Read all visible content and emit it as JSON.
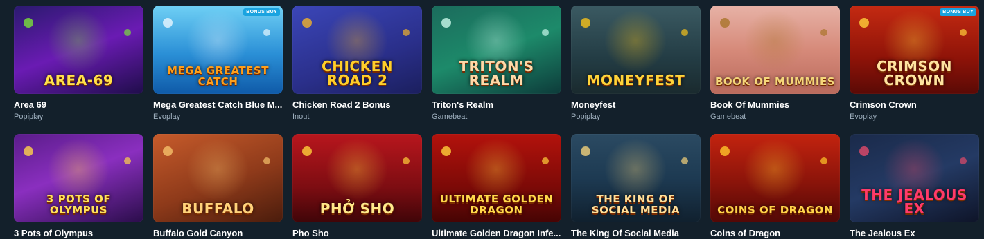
{
  "games": [
    {
      "name": "Area 69",
      "provider": "Popiplay",
      "art_text": "AREA-69",
      "badge": "",
      "bg": "linear-gradient(160deg,#2a1a6e 0%,#6a1bb3 50%,#1f0d4a 100%)",
      "accent": "#7be03a",
      "art_color": "#ffe14a"
    },
    {
      "name": "Mega Greatest Catch Blue M...",
      "provider": "Evoplay",
      "art_text": "MEGA GREATEST CATCH",
      "badge": "BONUS BUY",
      "bg": "linear-gradient(180deg,#6fd0f5 0%,#2a8fd6 55%,#0f5aa8 100%)",
      "accent": "#e8f6ff",
      "art_color": "#ff9f1a"
    },
    {
      "name": "Chicken Road 2 Bonus",
      "provider": "Inout",
      "art_text": "CHICKEN ROAD 2",
      "badge": "",
      "bg": "linear-gradient(160deg,#3b46b8 0%,#2a2f8a 60%,#1b1f5e 100%)",
      "accent": "#f1b22b",
      "art_color": "#ffcf2a"
    },
    {
      "name": "Triton's Realm",
      "provider": "Gamebeat",
      "art_text": "TRITON'S REALM",
      "badge": "",
      "bg": "linear-gradient(160deg,#1b6b5c 0%,#1d8a6a 50%,#0d3b3a 100%)",
      "accent": "#c9f7ea",
      "art_color": "#ffd9a8"
    },
    {
      "name": "Moneyfest",
      "provider": "Popiplay",
      "art_text": "MONEYFEST",
      "badge": "",
      "bg": "linear-gradient(180deg,#3b5a62 0%,#233c44 60%,#1a2a2e 100%)",
      "accent": "#f6c21a",
      "art_color": "#ffd43a"
    },
    {
      "name": "Book Of Mummies",
      "provider": "Gamebeat",
      "art_text": "BOOK OF MUMMIES",
      "badge": "",
      "bg": "linear-gradient(180deg,#e7b2a6 0%,#d68a7a 50%,#b96a5c 100%)",
      "accent": "#a9742a",
      "art_color": "#f5d77a"
    },
    {
      "name": "Crimson Crown",
      "provider": "Evoplay",
      "art_text": "CRIMSON CROWN",
      "badge": "BONUS BUY",
      "bg": "linear-gradient(180deg,#c42a12 0%,#8e1308 60%,#5a0a06 100%)",
      "accent": "#ffcf3a",
      "art_color": "#ffe3a0"
    },
    {
      "name": "3 Pots of Olympus",
      "provider": "",
      "art_text": "3 POTS OF OLYMPUS",
      "badge": "",
      "bg": "linear-gradient(160deg,#5a1c8a 0%,#8a2fbf 45%,#2a0d4a 100%)",
      "accent": "#ffd24a",
      "art_color": "#ffe25a"
    },
    {
      "name": "Buffalo Gold Canyon",
      "provider": "",
      "art_text": "BUFFALO",
      "badge": "",
      "bg": "linear-gradient(160deg,#c65b2b 0%,#8e3a1a 55%,#4a1c0c 100%)",
      "accent": "#f5c06a",
      "art_color": "#ffd27a"
    },
    {
      "name": "Pho Sho",
      "provider": "",
      "art_text": "PHỞ SHO",
      "badge": "",
      "bg": "linear-gradient(180deg,#b8161d 0%,#7d0d12 60%,#3f0508 100%)",
      "accent": "#ffcf3a",
      "art_color": "#ffe98a"
    },
    {
      "name": "Ultimate Golden Dragon Infe...",
      "provider": "",
      "art_text": "ULTIMATE GOLDEN DRAGON",
      "badge": "",
      "bg": "linear-gradient(180deg,#b3120c 0%,#7c0a07 60%,#450404 100%)",
      "accent": "#ffcf3a",
      "art_color": "#ffd84a"
    },
    {
      "name": "The King Of Social Media",
      "provider": "",
      "art_text": "THE KING OF SOCIAL MEDIA",
      "badge": "",
      "bg": "linear-gradient(180deg,#2b4a62 0%,#1d3a52 50%,#10202e 100%)",
      "accent": "#f3d17a",
      "art_color": "#ffe09a"
    },
    {
      "name": "Coins of Dragon",
      "provider": "",
      "art_text": "COINS OF DRAGON",
      "badge": "",
      "bg": "linear-gradient(180deg,#c3230f 0%,#8a140a 55%,#520806 100%)",
      "accent": "#ffc62a",
      "art_color": "#ffd34a"
    },
    {
      "name": "The Jealous Ex",
      "provider": "",
      "art_text": "THE JEALOUS EX",
      "badge": "",
      "bg": "linear-gradient(160deg,#1a2a4a 0%,#243a64 50%,#0e1428 100%)",
      "accent": "#e24a6a",
      "art_color": "#ff3a6a"
    }
  ]
}
